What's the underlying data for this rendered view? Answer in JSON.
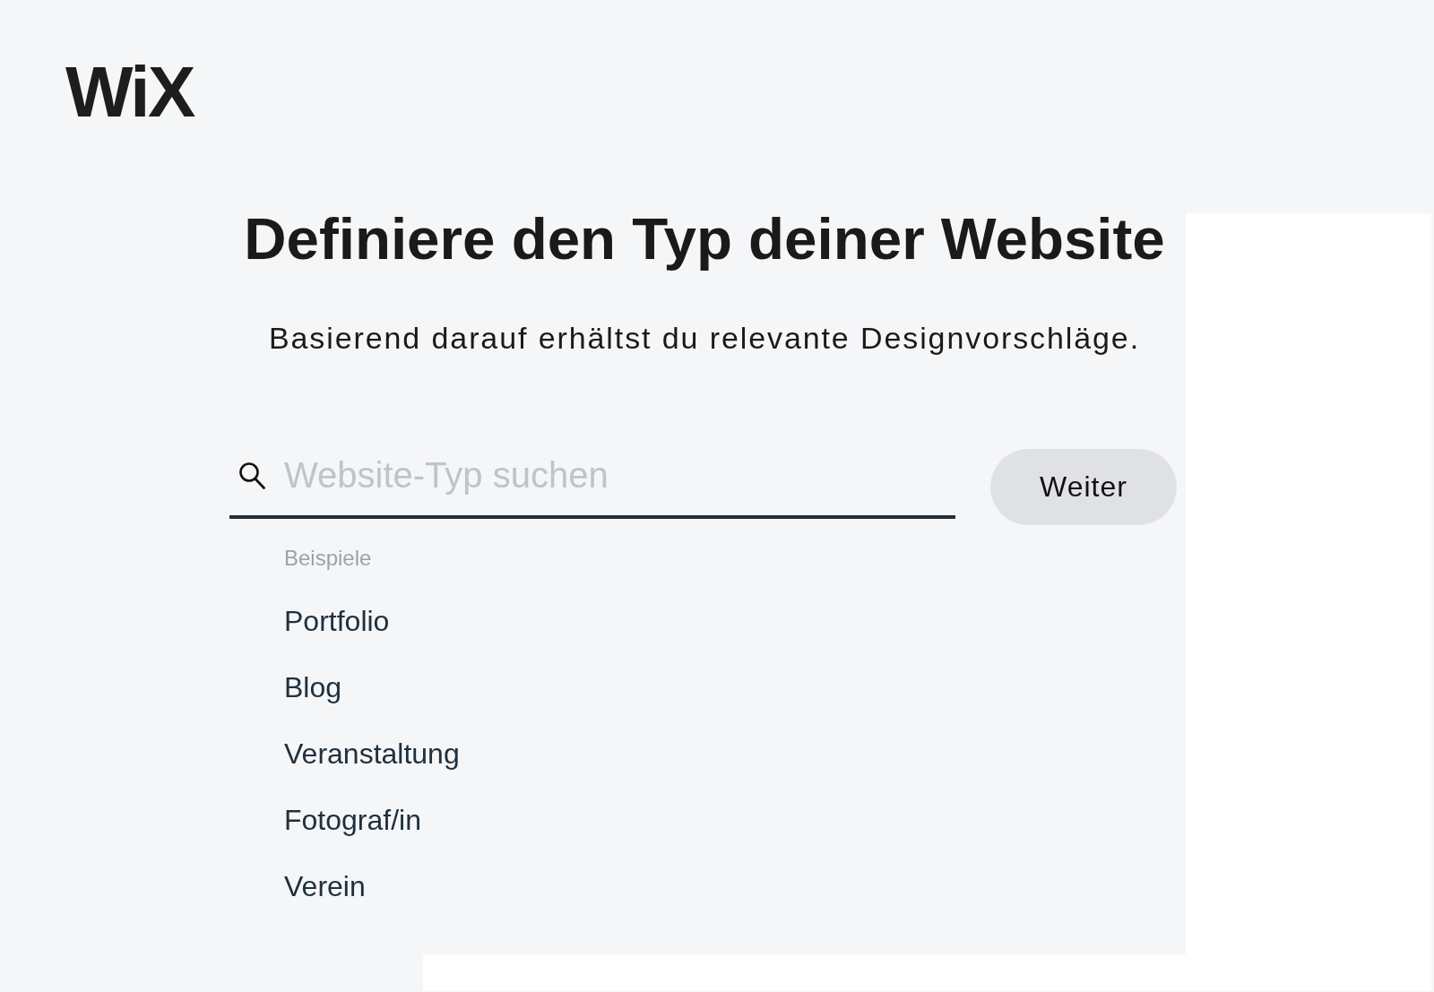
{
  "logo": {
    "text": "WiX"
  },
  "heading": "Definiere den Typ deiner Website",
  "subheading": "Basierend darauf erhältst du relevante Designvorschläge.",
  "search": {
    "placeholder": "Website-Typ suchen",
    "button": "Weiter"
  },
  "suggestions": {
    "label": "Beispiele",
    "items": [
      {
        "label": "Portfolio",
        "selected": false
      },
      {
        "label": "Blog",
        "selected": false
      },
      {
        "label": "Veranstaltung",
        "selected": false
      },
      {
        "label": "Fotograf/in",
        "selected": false
      },
      {
        "label": "Verein",
        "selected": false
      }
    ]
  }
}
